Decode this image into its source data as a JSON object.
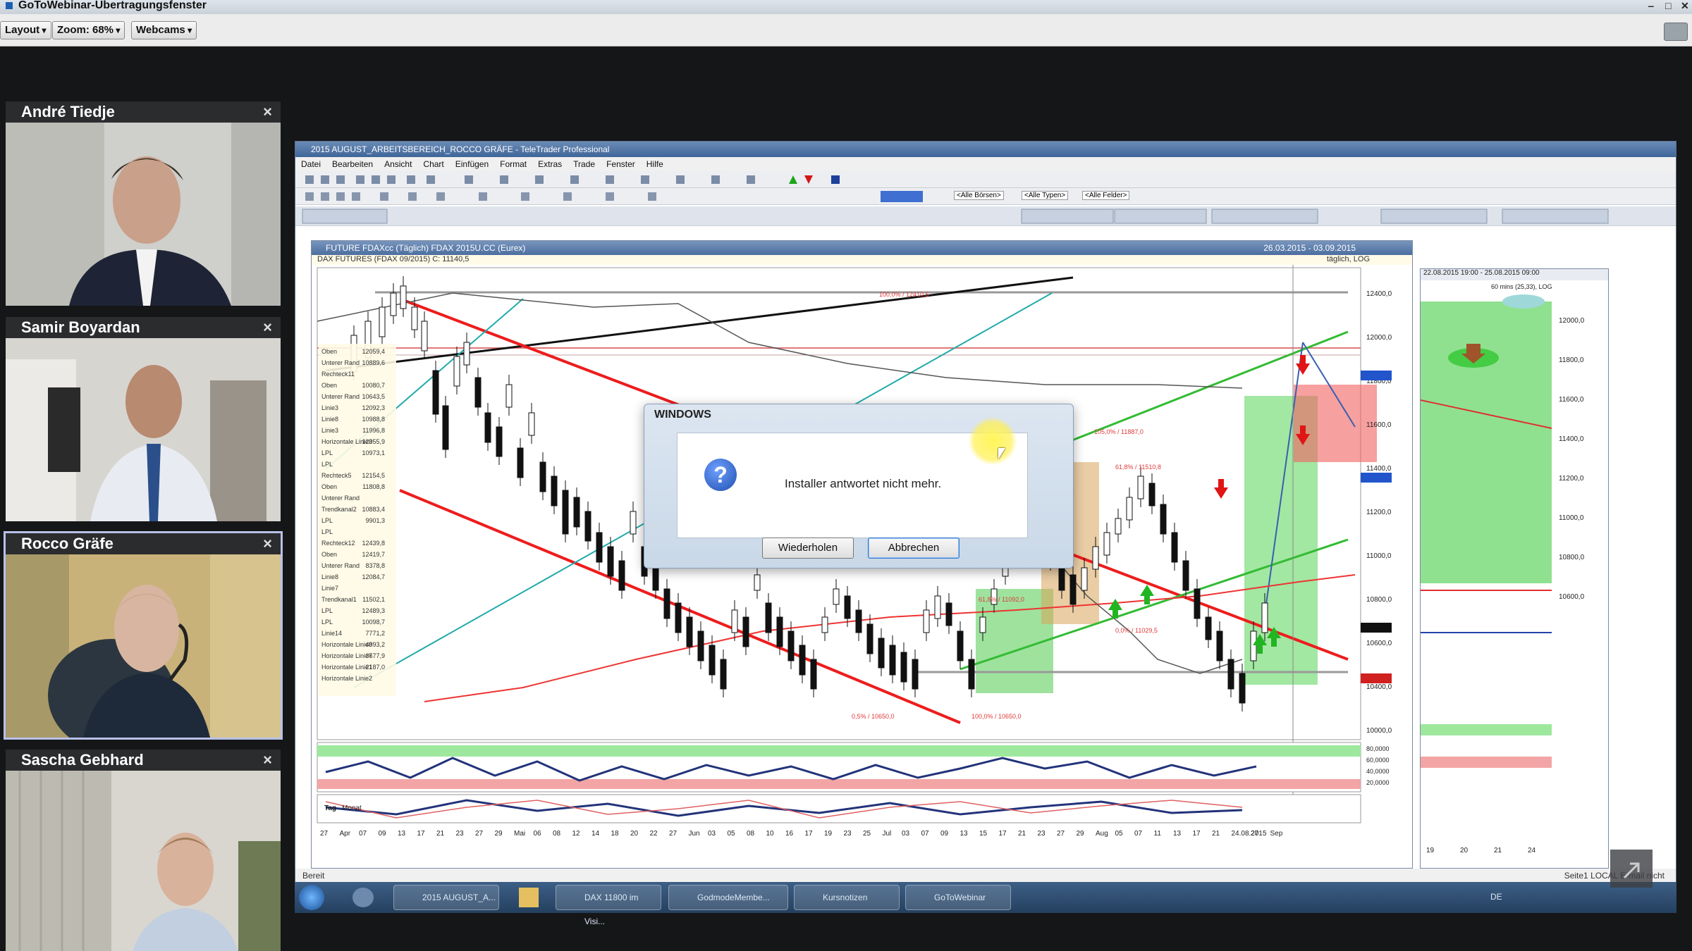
{
  "window": {
    "title": "GoToWebinar-Übertragungsfenster"
  },
  "toolbar": {
    "layout": "Layout",
    "zoom": "Zoom: 68%",
    "webcams": "Webcams"
  },
  "webcams": [
    {
      "name": "André Tiedje",
      "close": "×"
    },
    {
      "name": "Samir Boyardan",
      "close": "×"
    },
    {
      "name": "Rocco Gräfe",
      "close": "×"
    },
    {
      "name": "Sascha Gebhard",
      "close": "×"
    }
  ],
  "app": {
    "title": "2015 AUGUST_ARBEITSBEREICH_ROCCO GRÄFE - TeleTrader Professional",
    "menu": [
      "Datei",
      "Bearbeiten",
      "Ansicht",
      "Chart",
      "Einfügen",
      "Format",
      "Extras",
      "Trade",
      "Fenster",
      "Hilfe"
    ],
    "status": "Bereit",
    "status_right": "Seite1   LOCAL   E-mail nicht",
    "combos": [
      "<Alle Börsen>",
      "<Alle Typen>",
      "<Alle Felder>"
    ]
  },
  "chart": {
    "title": "FUTURE FDAXcc (Täglich)  FDAX 2015U.CC (Eurex)",
    "dates": "26.03.2015 - 03.09.2015",
    "info": "DAX FUTURES (FDAX 09/2015) C: 11140,5",
    "scale": "täglich, LOG",
    "y_ticks": [
      "12400,0",
      "12000,0",
      "11800,0",
      "11600,0",
      "11400,0",
      "11200,0",
      "11000,0",
      "10800,0",
      "10600,0",
      "10400,0",
      "10000,0"
    ],
    "x_ticks": [
      "27",
      "Apr",
      "07",
      "09",
      "13",
      "17",
      "21",
      "23",
      "27",
      "29",
      "Mai",
      "06",
      "08",
      "12",
      "14",
      "18",
      "20",
      "22",
      "27",
      "Jun",
      "03",
      "05",
      "08",
      "10",
      "16",
      "17",
      "19",
      "23",
      "25",
      "Jul",
      "03",
      "07",
      "09",
      "13",
      "15",
      "17",
      "21",
      "23",
      "27",
      "29",
      "Aug",
      "05",
      "07",
      "11",
      "13",
      "17",
      "21",
      "24.08.2015",
      "27",
      "Sep"
    ],
    "tabs": [
      "Tag",
      "Monat"
    ],
    "osc_ticks": [
      "80,0000",
      "60,0000",
      "40,0000",
      "20,0000"
    ],
    "annotations": [
      "100,0% / 12410,5",
      "105,0% / 11887,0",
      "61,8% / 11510,8",
      "61,8% / 11092,0",
      "0,0% / 11029,5",
      "0,5% / 10650,0",
      "100,0% / 10650,0"
    ],
    "legend": [
      "Oben",
      "Unterer Rand",
      "Rechteck11",
      "Oben",
      "Unterer Rand",
      "Linie3",
      "Linie8",
      "Linie3",
      "Horizontale Linie3",
      "LPL",
      "LPL",
      "Rechteck5",
      "Oben",
      "Unterer Rand",
      "Trendkanal2",
      "LPL",
      "LPL",
      "Rechteck12",
      "Oben",
      "Unterer Rand",
      "Linie8",
      "Linie7",
      "Trendkanal1",
      "LPL",
      "LPL",
      "Linie14",
      "Horizontale Linie8",
      "Horizontale Linie7",
      "Horizontale Linie1",
      "Horizontale Linie2"
    ],
    "legend_values": [
      "12059,4",
      "10889,6",
      "",
      "10080,7",
      "10643,5",
      "12092,3",
      "10988,8",
      "11996,8",
      "12055,9",
      "10973,1",
      "",
      "12154,5",
      "11808,8",
      "",
      "10883,4",
      "9901,3",
      "",
      "12439,8",
      "12419,7",
      "8378,8",
      "12084,7",
      "",
      "11502,1",
      "12489,3",
      "10098,7",
      "7771,2",
      "4093,2",
      "3677,9",
      "2187,0",
      ""
    ]
  },
  "right_chart": {
    "title": "22.08.2015 19:00 - 25.08.2015 09:00",
    "scale": "60 mins (25,33), LOG",
    "y_ticks": [
      "12000,0",
      "11800,0",
      "11600,0",
      "11400,0",
      "11200,0",
      "11000,0",
      "10800,0",
      "10600,0"
    ],
    "x_ticks": [
      "19",
      "20",
      "21",
      "24"
    ]
  },
  "dialog": {
    "title": "WINDOWS",
    "message": "Installer antwortet nicht mehr.",
    "retry": "Wiederholen",
    "cancel": "Abbrechen"
  },
  "taskbar": [
    {
      "label": "2015 AUGUST_A..."
    },
    {
      "label": "DAX 11800 im Visi..."
    },
    {
      "label": "GodmodeMembe..."
    },
    {
      "label": "Kursnotizen"
    },
    {
      "label": "GoToWebinar"
    }
  ],
  "taskbar_tray": "DE"
}
